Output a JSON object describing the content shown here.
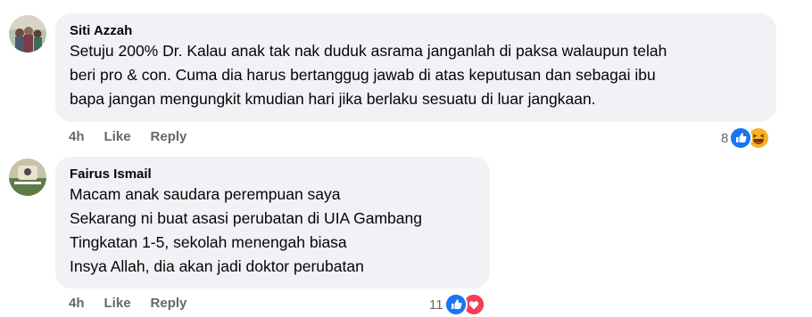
{
  "comments": [
    {
      "author": "Siti Azzah",
      "lines": [
        "Setuju 200% Dr. Kalau anak tak nak duduk asrama janganlah di paksa walaupun telah",
        "beri pro & con. Cuma dia harus bertanggug jawab di atas keputusan dan sebagai ibu",
        "bapa jangan mengungkit kmudian hari jika berlaku sesuatu di luar jangkaan."
      ],
      "time": "4h",
      "like_label": "Like",
      "reply_label": "Reply",
      "reaction_count": "8",
      "reactions": [
        "like-icon",
        "haha-icon"
      ]
    },
    {
      "author": "Fairus Ismail",
      "lines": [
        "Macam anak saudara perempuan saya",
        "Sekarang ni buat asasi perubatan di UIA Gambang",
        "Tingkatan 1-5, sekolah menengah biasa",
        "Insya Allah, dia akan jadi doktor perubatan"
      ],
      "time": "4h",
      "like_label": "Like",
      "reply_label": "Reply",
      "reaction_count": "11",
      "reactions": [
        "like-icon",
        "love-icon"
      ]
    }
  ],
  "colors": {
    "bubble": "#f0f2f5",
    "action_text": "#65676b",
    "like_blue": "#1877f2",
    "love_red": "#f33e58",
    "haha_yellow": "#f7b125"
  }
}
